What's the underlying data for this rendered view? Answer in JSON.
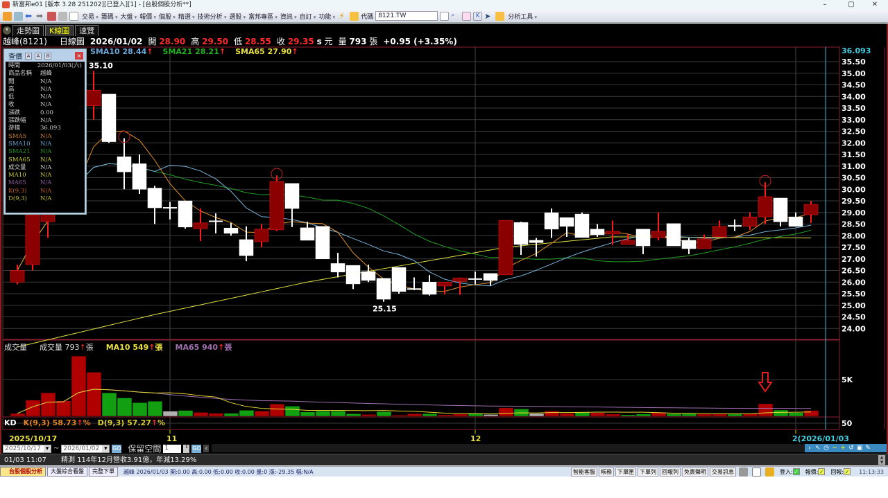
{
  "window": {
    "title": "新富邦e01 [版本 3.28 251202][已登入][1] - [台股個股分析**]",
    "minimize": "–",
    "restore": "▢",
    "close": "✕"
  },
  "toolbar": {
    "menus": [
      "交易",
      "籌碼",
      "大盤",
      "報價",
      "個股",
      "精選",
      "技術分析",
      "選股",
      "富邦專區",
      "資訊",
      "自訂",
      "功能"
    ],
    "code_label": "代碼",
    "code_value": "8121.TW",
    "analysis_tools": "分析工具"
  },
  "tabs": [
    "走勢圖",
    "K線圖",
    "速覽"
  ],
  "quote": {
    "name": "越峰(8121)",
    "chart_type": "日線圖",
    "date": "2026/01/02",
    "open_label": "開",
    "open": "28.90",
    "high_label": "高",
    "high": "29.50",
    "low_label": "低",
    "low": "28.55",
    "close_label": "收",
    "close": "29.35",
    "s": "s",
    "unit": "元",
    "vol_label": "量",
    "vol": "793",
    "vol_unit": "張",
    "change": "+0.95 (+3.35%)"
  },
  "legend": {
    "sma10": "SMA10 28.44",
    "sma21": "SMA21 28.21",
    "sma65": "SMA65 27.90",
    "arrow": "↑"
  },
  "panel": {
    "title": "查價",
    "close": "×",
    "rows": [
      [
        "時間",
        "2026/01/03(六)",
        "#ccc"
      ],
      [
        "商品名稱",
        "越峰",
        "#ccc"
      ],
      [
        "開",
        "N/A",
        "#ccc"
      ],
      [
        "高",
        "N/A",
        "#ccc"
      ],
      [
        "低",
        "N/A",
        "#ccc"
      ],
      [
        "收",
        "N/A",
        "#ccc"
      ],
      [
        "漲跌",
        "0.00",
        "#ccc"
      ],
      [
        "漲跌幅",
        "N/A",
        "#ccc"
      ],
      [
        "游標",
        "36.093",
        "#ccc"
      ],
      [
        "SMA5",
        "N/A",
        "#d08030"
      ],
      [
        "SMA10",
        "N/A",
        "#6aa8d8"
      ],
      [
        "SMA21",
        "N/A",
        "#20a020"
      ],
      [
        "SMA65",
        "N/A",
        "#d0d030"
      ],
      [
        "成交量",
        "N/A",
        "#ccc"
      ],
      [
        "MA10",
        "N/A",
        "#d0d030"
      ],
      [
        "MA65",
        "N/A",
        "#9060a0"
      ],
      [
        "K(9,3)",
        "N/A",
        "#c06020"
      ],
      [
        "D(9,3)",
        "N/A",
        "#c0c020"
      ]
    ]
  },
  "volume_labels": {
    "title": "成交量",
    "vol": "成交量 793",
    "ma10": "MA10 549",
    "ma65": "MA65 940",
    "unit": "張",
    "arrow": "↑"
  },
  "kd": {
    "title": "KD",
    "k": "K(9,3) 58.73",
    "d": "D(9,3) 57.27",
    "unit": "%",
    "arrow": "↑",
    "level": "50"
  },
  "date_axis": {
    "start": "2025/10/17",
    "m11": "11",
    "m12": "12",
    "end": "2(2026/01/03"
  },
  "date_controls": {
    "from": "2025/10/17",
    "tilde": "~",
    "to": "2026/01/02",
    "go": "GO",
    "reserve_label": "保留空間",
    "reserve_value": "1",
    "go2": "GO",
    "prev": "‹",
    "next": "›"
  },
  "status": {
    "time": "01/03 11:07",
    "news": "精測 114年12月營收3.91億，年減13.29%"
  },
  "bottom": {
    "tabs": [
      "台股個股分析",
      "大盤綜合看盤",
      "完整下單"
    ],
    "ticker": "越峰 2026/01/03 開:0.00 高:0.00 低:0.00 收:0.00 量:0 漲:-29.35 幅:N/A",
    "buttons": [
      "智能客服",
      "帳務",
      "下單匣",
      "下單列",
      "回報列",
      "免責聲明",
      "交易訊息"
    ],
    "login": "登入:",
    "quote": "報價:",
    "report": "回報:",
    "check": "✓",
    "clock": "11:13:33"
  },
  "chart_data": {
    "type": "candlestick",
    "y_ticks": [
      "35.50",
      "35.00",
      "34.50",
      "34.00",
      "33.50",
      "33.00",
      "32.50",
      "32.00",
      "31.50",
      "31.00",
      "30.50",
      "30.00",
      "29.50",
      "29.00",
      "28.50",
      "28.00",
      "27.50",
      "27.00",
      "26.50",
      "26.00",
      "25.50",
      "25.00",
      "24.50",
      "24.00"
    ],
    "y_top": "36.093",
    "ylim": [
      23.7,
      36.093
    ],
    "ohlc": [
      [
        26.0,
        26.75,
        25.9,
        26.5
      ],
      [
        26.75,
        29.3,
        26.5,
        28.9
      ],
      [
        28.6,
        31.0,
        27.9,
        30.5
      ],
      [
        30.4,
        32.3,
        30.0,
        32.0
      ],
      [
        32.0,
        34.0,
        31.5,
        33.5
      ],
      [
        33.6,
        35.1,
        33.0,
        34.27
      ],
      [
        34.1,
        34.1,
        32.0,
        32.05
      ],
      [
        31.4,
        32.2,
        30.0,
        30.75
      ],
      [
        31.1,
        31.5,
        29.8,
        30.0
      ],
      [
        30.05,
        30.15,
        28.5,
        29.2
      ],
      [
        29.2,
        29.45,
        28.7,
        29.2
      ],
      [
        29.5,
        29.5,
        28.3,
        28.37
      ],
      [
        28.3,
        29.17,
        27.77,
        28.55
      ],
      [
        28.62,
        28.96,
        28.1,
        28.6
      ],
      [
        28.33,
        28.55,
        28.0,
        28.1
      ],
      [
        27.83,
        28.4,
        26.9,
        27.14
      ],
      [
        27.74,
        28.5,
        27.5,
        28.28
      ],
      [
        28.25,
        30.6,
        28.2,
        30.34
      ],
      [
        30.25,
        30.25,
        28.37,
        29.17
      ],
      [
        28.34,
        28.6,
        27.8,
        27.8
      ],
      [
        28.4,
        28.4,
        27.0,
        27.0
      ],
      [
        26.8,
        27.26,
        26.2,
        26.43
      ],
      [
        26.72,
        26.72,
        25.7,
        25.92
      ],
      [
        26.45,
        26.75,
        26.0,
        26.07
      ],
      [
        26.16,
        26.16,
        25.15,
        25.26
      ],
      [
        26.63,
        26.63,
        25.5,
        25.59
      ],
      [
        25.7,
        26.2,
        25.65,
        25.68
      ],
      [
        26.0,
        26.3,
        25.42,
        25.47
      ],
      [
        25.83,
        26.0,
        25.47,
        26.0
      ],
      [
        26.03,
        26.2,
        25.45,
        26.18
      ],
      [
        26.13,
        26.45,
        25.9,
        26.12
      ],
      [
        26.37,
        26.37,
        25.85,
        26.07
      ],
      [
        26.31,
        28.66,
        26.31,
        28.66
      ],
      [
        28.57,
        28.6,
        27.17,
        27.62
      ],
      [
        27.8,
        27.9,
        27.1,
        27.7
      ],
      [
        28.99,
        29.17,
        27.9,
        28.28
      ],
      [
        28.78,
        28.78,
        27.95,
        28.4
      ],
      [
        28.93,
        29.0,
        27.92,
        27.92
      ],
      [
        28.28,
        28.5,
        27.95,
        28.04
      ],
      [
        28.07,
        28.65,
        27.6,
        28.19
      ],
      [
        27.62,
        28.05,
        27.62,
        27.8
      ],
      [
        28.28,
        28.28,
        27.2,
        27.56
      ],
      [
        27.92,
        28.99,
        27.8,
        28.19
      ],
      [
        28.52,
        28.52,
        27.56,
        27.56
      ],
      [
        27.8,
        27.9,
        27.2,
        27.44
      ],
      [
        27.44,
        28.05,
        27.44,
        27.86
      ],
      [
        27.95,
        28.65,
        27.95,
        28.4
      ],
      [
        28.42,
        28.7,
        28.2,
        28.4
      ],
      [
        28.4,
        29.0,
        28.25,
        28.81
      ],
      [
        28.81,
        30.3,
        28.5,
        29.68
      ],
      [
        29.62,
        29.62,
        28.4,
        28.6
      ],
      [
        28.81,
        29.0,
        28.4,
        28.4
      ],
      [
        28.9,
        29.5,
        28.55,
        29.35
      ]
    ],
    "sma65_anchors": [
      [
        1,
        23.2
      ],
      [
        10,
        24.6
      ],
      [
        20,
        26.0
      ],
      [
        33,
        27.5
      ],
      [
        40,
        27.95
      ],
      [
        53,
        27.9
      ]
    ],
    "annotations": {
      "high_label": "35.10",
      "high_index": 6,
      "low_label": "25.15",
      "low_index": 25,
      "circled": [
        8,
        18,
        50
      ],
      "arrow_index": 50
    },
    "volume": [
      380,
      2200,
      3200,
      2100,
      8200,
      6000,
      3200,
      2500,
      1850,
      2050,
      700,
      800,
      530,
      410,
      410,
      820,
      720,
      1670,
      1380,
      600,
      720,
      720,
      350,
      250,
      630,
      160,
      350,
      350,
      200,
      300,
      350,
      250,
      1150,
      1000,
      380,
      720,
      400,
      600,
      500,
      300,
      200,
      300,
      500,
      350,
      350,
      300,
      300,
      300,
      400,
      1700,
      850,
      500,
      793
    ],
    "volume_dir": "rrrrrrggggwgrrggrrgggggrgrrgrrgwrgwrrgrrggrggrrgrrggr",
    "volume_tick": "5K",
    "colors": {
      "up": "#ff1a1a",
      "up_body": "#8b0000",
      "down": "#ffffff",
      "sma5": "#e0902c",
      "sma10": "#78b4dc",
      "sma21": "#22a022",
      "sma65": "#e0e040",
      "vol_up": "#b00000",
      "vol_down": "#12a012",
      "vol_flat": "#b0b0b0",
      "vma10": "#e8d830",
      "vma65": "#a070b0",
      "grid": "#3a3a3a",
      "frame": "#8b2030",
      "cursor": "#40c0d8"
    }
  }
}
